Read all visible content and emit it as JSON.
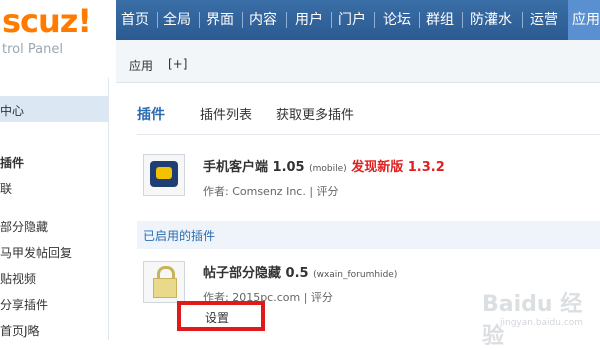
{
  "logo": {
    "text": "scuz!",
    "subtitle": "trol Panel"
  },
  "topnav": [
    "首页",
    "全局",
    "界面",
    "内容",
    "用户",
    "门户",
    "论坛",
    "群组",
    "防灌水",
    "运营",
    "应用"
  ],
  "subbar": {
    "app": "应用",
    "add": "[+]"
  },
  "sidebar": {
    "items": [
      "中心",
      "插件",
      "联",
      "部分隐藏",
      "马甲发帖回复",
      "贴视频",
      "分享插件",
      "首页J略"
    ]
  },
  "tabs": [
    "插件",
    "插件列表",
    "获取更多插件"
  ],
  "plugins": {
    "mobile": {
      "title": "手机客户端 1.05",
      "tag": "(mobile)",
      "update_label": "发现新版 1.3.2",
      "author": "作者: Comsenz Inc.",
      "rate": "| 评分"
    },
    "enabled_header": "已启用的插件",
    "hide": {
      "title": "帖子部分隐藏 0.5",
      "tag": "(wxain_forumhide)",
      "author": "作者: 2015pc.com",
      "rate": "| 评分",
      "settings": "设置"
    }
  },
  "watermark": {
    "main": "Baidu 经验",
    "sub": "jingyan.baidu.com"
  },
  "colors": {
    "nav": "#2e5e97",
    "accent": "#2b6cb0",
    "alert": "#e02020",
    "logo": "#ff7b00"
  }
}
